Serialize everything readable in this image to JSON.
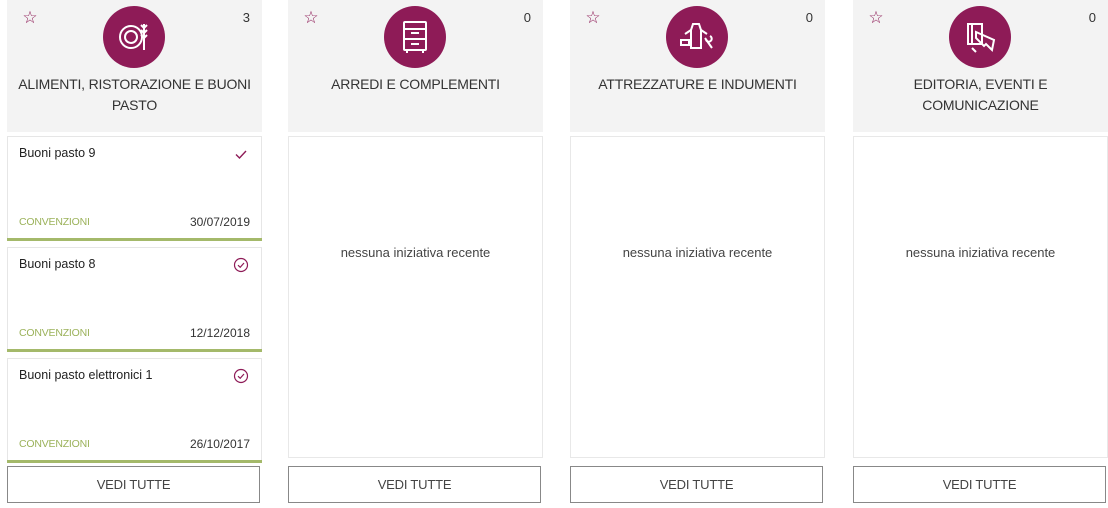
{
  "colors": {
    "accent": "#8e1b57",
    "convenzioni": "#9bb25a",
    "bar": "#a4b96a"
  },
  "categories": [
    {
      "title": "ALIMENTI, RISTORAZIONE E BUONI PASTO",
      "count": "3",
      "icon": "food-plate-wheat-icon",
      "cards": [
        {
          "title": "Buoni pasto 9",
          "type": "CONVENZIONI",
          "date": "30/07/2019",
          "status": "check-icon"
        },
        {
          "title": "Buoni pasto 8",
          "type": "CONVENZIONI",
          "date": "12/12/2018",
          "status": "circle-check-icon"
        },
        {
          "title": "Buoni pasto elettronici 1",
          "type": "CONVENZIONI",
          "date": "26/10/2017",
          "status": "circle-check-icon"
        }
      ],
      "see_all": "VEDI TUTTE"
    },
    {
      "title": "ARREDI E COMPLEMENTI",
      "count": "0",
      "icon": "drawer-cabinet-icon",
      "empty_text": "nessuna iniziativa recente",
      "see_all": "VEDI TUTTE"
    },
    {
      "title": "ATTREZZATURE E INDUMENTI",
      "count": "0",
      "icon": "tools-clothing-icon",
      "empty_text": "nessuna iniziativa recente",
      "see_all": "VEDI TUTTE"
    },
    {
      "title": "EDITORIA, EVENTI E COMUNICAZIONE",
      "count": "0",
      "icon": "book-megaphone-icon",
      "empty_text": "nessuna iniziativa recente",
      "see_all": "VEDI TUTTE"
    }
  ]
}
